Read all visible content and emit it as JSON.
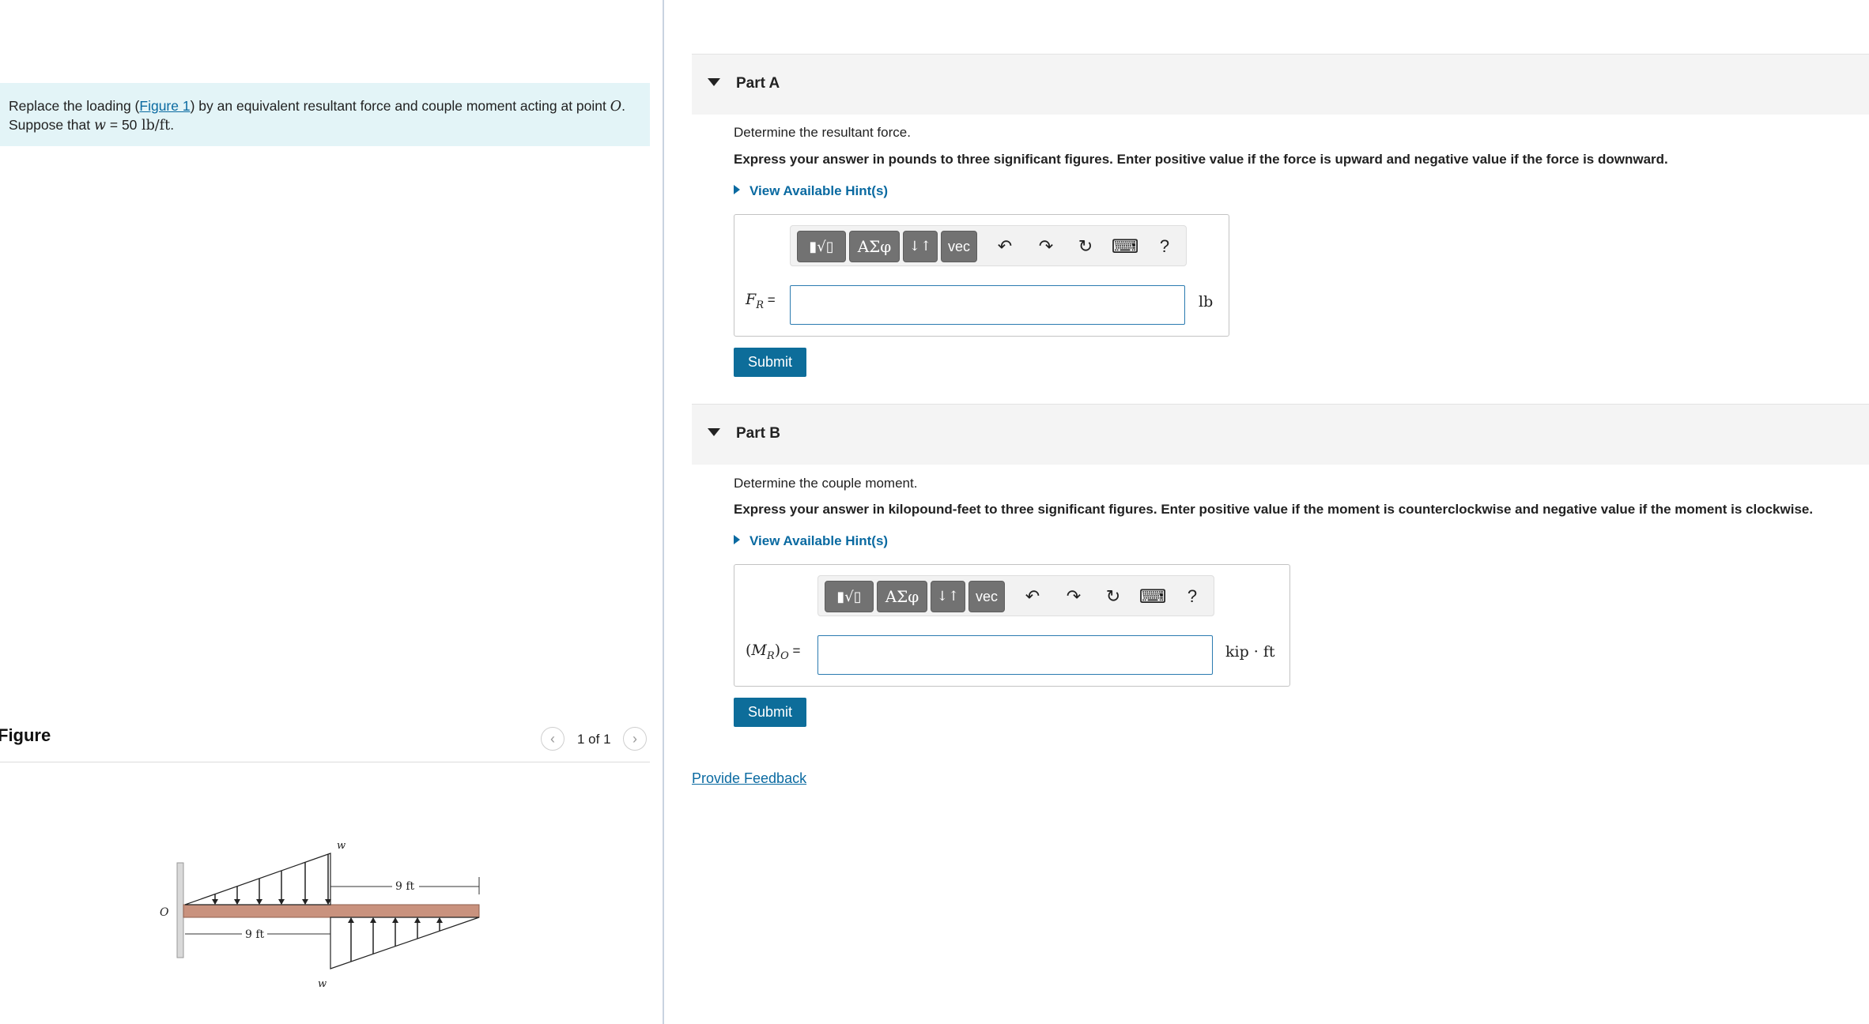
{
  "problem": {
    "text_before_link": "Replace the loading (",
    "figure_link": "Figure 1",
    "text_after_link": ") by an equivalent resultant force and couple moment acting at point ",
    "point": "O",
    "period": ".",
    "line2_prefix": "Suppose that ",
    "w_symbol": "w",
    "equals": " = ",
    "w_value": "50",
    "w_unit": " lb/ft",
    "line2_suffix": "."
  },
  "figure": {
    "title": "Figure",
    "pager": "1 of 1",
    "prev_glyph": "‹",
    "next_glyph": "›",
    "labels": {
      "w_top": "w",
      "w_bottom": "w",
      "span_top": "9 ft",
      "span_bottom": "9 ft",
      "point": "O"
    }
  },
  "toolbar": {
    "templates_glyph": "▮√▯",
    "greek_glyph": "ΑΣφ",
    "arrows_glyph": "↓↑",
    "vec_label": "vec",
    "undo_glyph": "↶",
    "redo_glyph": "↷",
    "reset_glyph": "↻",
    "keyboard_glyph": "⌨",
    "help_glyph": "?"
  },
  "parts": [
    {
      "label": "Part A",
      "instruction": "Determine the resultant force.",
      "instruction_bold": "Express your answer in pounds to three significant figures. Enter positive value if the force is upward and negative value if the force is downward.",
      "hint": "View Available Hint(s)",
      "variable_main": "F",
      "variable_sub": "R",
      "eq": " =",
      "input_value": "",
      "unit": "lb",
      "submit": "Submit"
    },
    {
      "label": "Part B",
      "instruction": "Determine the couple moment.",
      "instruction_bold": "Express your answer in kilopound-feet to three significant figures. Enter positive value if the moment is counterclockwise and negative value if the moment is clockwise.",
      "hint": "View Available Hint(s)",
      "variable_open": "(",
      "variable_main": "M",
      "variable_sub": "R",
      "variable_close": ")",
      "variable_sub2": "O",
      "eq": " =",
      "input_value": "",
      "unit": "kip · ft",
      "submit": "Submit"
    }
  ],
  "feedback": "Provide Feedback"
}
